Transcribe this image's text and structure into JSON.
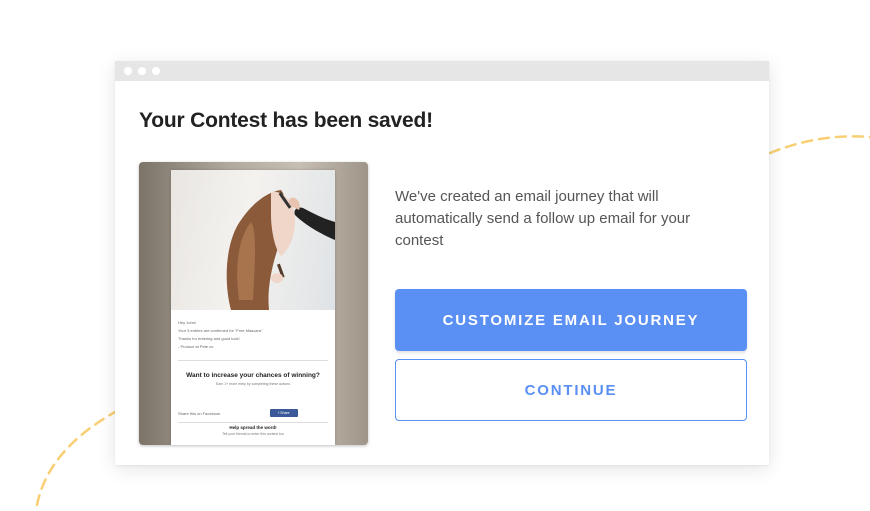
{
  "window": {
    "heading": "Your Contest has been saved!"
  },
  "message": "We've created an email journey that will automatically send a follow up email for your contest",
  "buttons": {
    "customize_label": "CUSTOMIZE EMAIL JOURNEY",
    "continue_label": "CONTINUE"
  },
  "preview": {
    "greeting": "Hey John!",
    "line1": "Your 5 entries are confirmed for \"Free Mascara\"",
    "line2": "Thanks for entering and good luck!",
    "line3": "- Product at Pete co",
    "cta_title": "Want to increase your chances of winning?",
    "cta_sub": "Earn 1+ more entry by completing these actions",
    "share_label": "Share this on Facebook",
    "share_button": "f  Share",
    "spread_title": "Help spread the word!",
    "spread_sub": "Tell your friends to enter this contest too"
  },
  "colors": {
    "accent": "#5a8ff3",
    "decor": "#f8cf73"
  }
}
